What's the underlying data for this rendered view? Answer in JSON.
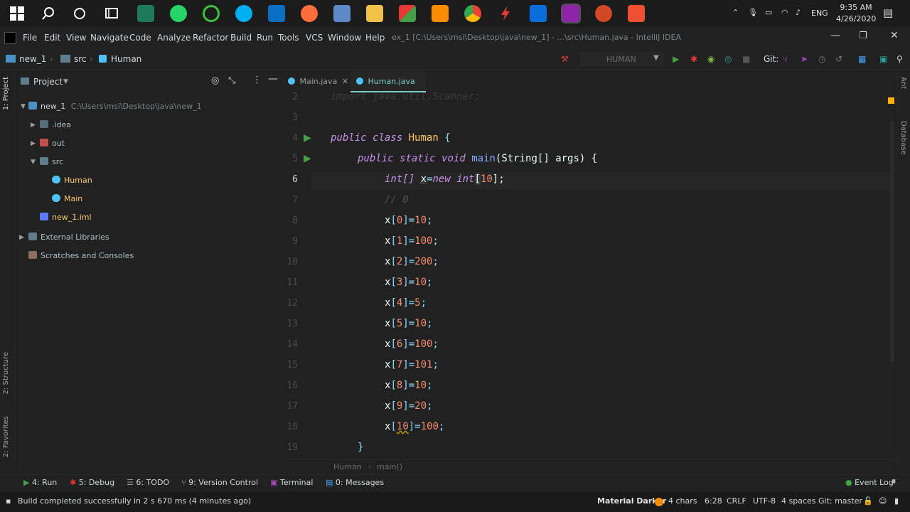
{
  "taskbar": {
    "clock_time": "9:35 AM",
    "clock_date": "4/26/2020",
    "language": "ENG"
  },
  "menu": {
    "items": [
      "File",
      "Edit",
      "View",
      "Navigate",
      "Code",
      "Analyze",
      "Refactor",
      "Build",
      "Run",
      "Tools",
      "VCS",
      "Window",
      "Help"
    ],
    "window_title": "ex_1 [C:\\Users\\msi\\Desktop\\java\\new_1] - ...\\src\\Human.java - IntelliJ IDEA"
  },
  "nav": {
    "crumbs": [
      "new_1",
      "src",
      "Human"
    ],
    "run_config": "HUMAN",
    "git_label": "Git:"
  },
  "project_panel": {
    "title": "Project",
    "root_name": "new_1",
    "root_path": "C:\\Users\\msi\\Desktop\\java\\new_1",
    "items": [
      ".idea",
      "out",
      "src",
      "Human",
      "Main",
      "new_1.iml",
      "External Libraries",
      "Scratches and Consoles"
    ]
  },
  "tabs": [
    {
      "label": "Main.java"
    },
    {
      "label": "Human.java"
    }
  ],
  "editor": {
    "line_numbers": [
      "2",
      "3",
      "4",
      "5",
      "6",
      "7",
      "8",
      "9",
      "10",
      "11",
      "12",
      "13",
      "14",
      "15",
      "16",
      "17",
      "18",
      "19"
    ],
    "line2": "import java.util.Scanner;",
    "line4": {
      "kw1": "public",
      "kw2": "class",
      "name": "Human",
      "brace": "{"
    },
    "line5": {
      "kw1": "public",
      "kw2": "static",
      "kw3": "void",
      "fn": "main",
      "params": "(String[] args) {"
    },
    "line6": {
      "kw1": "int[]",
      "var": "x",
      "eq": "=",
      "kw2": "new",
      "kw3": "int",
      "open": "[",
      "num": "10",
      "close": "];"
    },
    "line7": "// 0",
    "assignments": [
      {
        "idx": "0",
        "val": "10"
      },
      {
        "idx": "1",
        "val": "100"
      },
      {
        "idx": "2",
        "val": "200"
      },
      {
        "idx": "3",
        "val": "10"
      },
      {
        "idx": "4",
        "val": "5"
      },
      {
        "idx": "5",
        "val": "10"
      },
      {
        "idx": "6",
        "val": "100"
      },
      {
        "idx": "7",
        "val": "101"
      },
      {
        "idx": "8",
        "val": "10"
      },
      {
        "idx": "9",
        "val": "20"
      },
      {
        "idx": "10",
        "val": "100"
      }
    ],
    "line19": "}"
  },
  "editor_breadcrumb": [
    "Human",
    "main()"
  ],
  "tool_windows": {
    "run": "4: Run",
    "debug": "5: Debug",
    "todo": "6: TODO",
    "vcs": "9: Version Control",
    "terminal": "Terminal",
    "messages": "0: Messages",
    "event_log": "Event Log"
  },
  "left_tabs": [
    "1: Project",
    "2: Structure",
    "2: Favorites"
  ],
  "right_tabs": [
    "Ant",
    "Database"
  ],
  "status": {
    "message": "Build completed successfully in 2 s 670 ms (4 minutes ago)",
    "theme": "Material Darker",
    "chars": "4 chars",
    "position": "6:28",
    "line_sep": "CRLF",
    "encoding": "UTF-8",
    "indent": "4 spaces",
    "git_branch": "Git: master"
  },
  "colors": {
    "keyword": "#c792ea",
    "class": "#ffcb6b",
    "function": "#82aaff",
    "number": "#f78c6c",
    "accent": "#80cbc4"
  }
}
